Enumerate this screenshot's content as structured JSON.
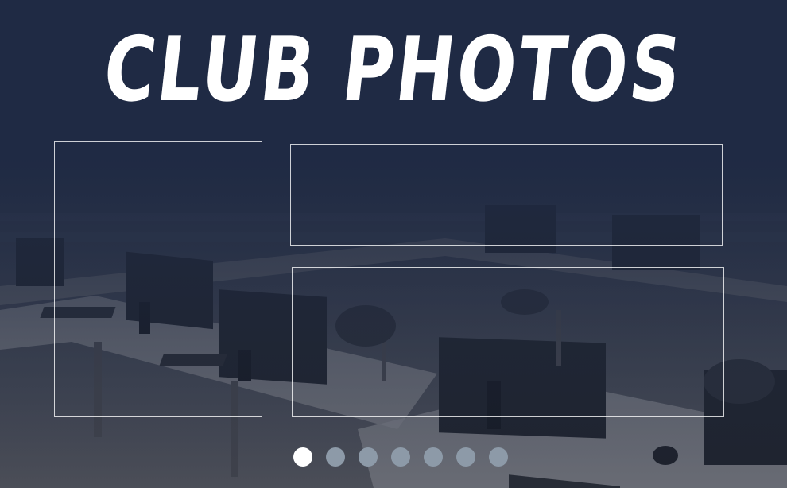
{
  "header": {
    "title": "CLUB PHOTOS"
  },
  "gallery": {
    "frames": [
      {
        "name": "photo-frame-1"
      },
      {
        "name": "photo-frame-2"
      },
      {
        "name": "photo-frame-3"
      }
    ]
  },
  "carousel": {
    "page_count": 7,
    "active_index": 0,
    "colors": {
      "active": "#ffffff",
      "inactive": "#8d9aa8"
    }
  },
  "theme": {
    "background": "#1f2a44"
  }
}
